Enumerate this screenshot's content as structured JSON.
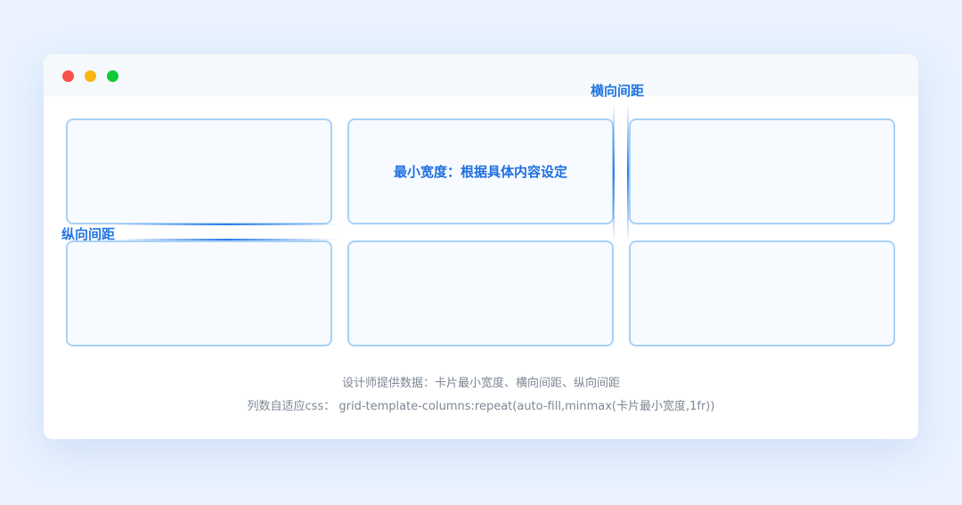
{
  "window": {
    "controls": [
      "close",
      "minimize",
      "maximize"
    ]
  },
  "labels": {
    "horizontal_gap": "横向间距",
    "vertical_gap": "纵向间距",
    "min_width": "最小宽度：根据具体内容设定"
  },
  "captions": {
    "line1": "设计师提供数据：卡片最小宽度、横向间距、纵向间距",
    "line2": "列数自适应css： grid-template-columns:repeat(auto-fill,minmax(卡片最小宽度,1fr))"
  },
  "grid": {
    "rows": 2,
    "columns": 3
  },
  "colors": {
    "accent": "#2275e0",
    "card_border": "#a8d1f6",
    "card_fill": "#f7fbff",
    "page_background": "#e9f2fe",
    "caption_text": "#7d8794"
  }
}
